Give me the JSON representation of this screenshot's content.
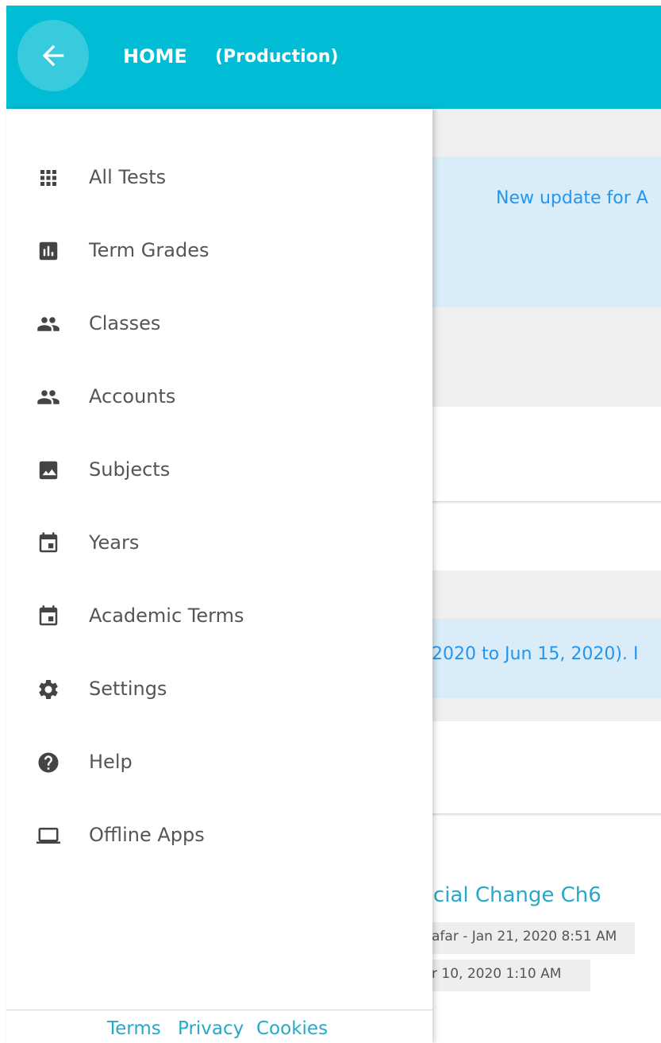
{
  "header": {
    "title": "HOME",
    "environment": "(Production)",
    "back_icon": "arrow-left-icon",
    "color": "#00bcd4"
  },
  "drawer": {
    "items": [
      {
        "label": "All Tests",
        "icon": "grid-icon"
      },
      {
        "label": "Term Grades",
        "icon": "bar-chart-icon"
      },
      {
        "label": "Classes",
        "icon": "people-icon"
      },
      {
        "label": "Accounts",
        "icon": "people-icon"
      },
      {
        "label": "Subjects",
        "icon": "image-icon"
      },
      {
        "label": "Years",
        "icon": "calendar-icon"
      },
      {
        "label": "Academic Terms",
        "icon": "calendar-icon"
      },
      {
        "label": "Settings",
        "icon": "gear-icon"
      },
      {
        "label": "Help",
        "icon": "help-icon"
      },
      {
        "label": "Offline Apps",
        "icon": "laptop-icon"
      }
    ],
    "footer": {
      "terms": "Terms",
      "privacy": "Privacy",
      "cookies": "Cookies"
    }
  },
  "background": {
    "notice_update": "New update for A",
    "notice_dates": ", 2020 to Jun 15, 2020). I",
    "test_title": "ocial Change Ch6",
    "test_meta_1": "afar - Jan 21, 2020 8:51 AM",
    "test_meta_2": "r 10, 2020 1:10 AM"
  },
  "colors": {
    "accent": "#00bcd4",
    "link": "#26a9c9",
    "notice_text": "#2196f3",
    "notice_bg": "#d9ecf7"
  }
}
